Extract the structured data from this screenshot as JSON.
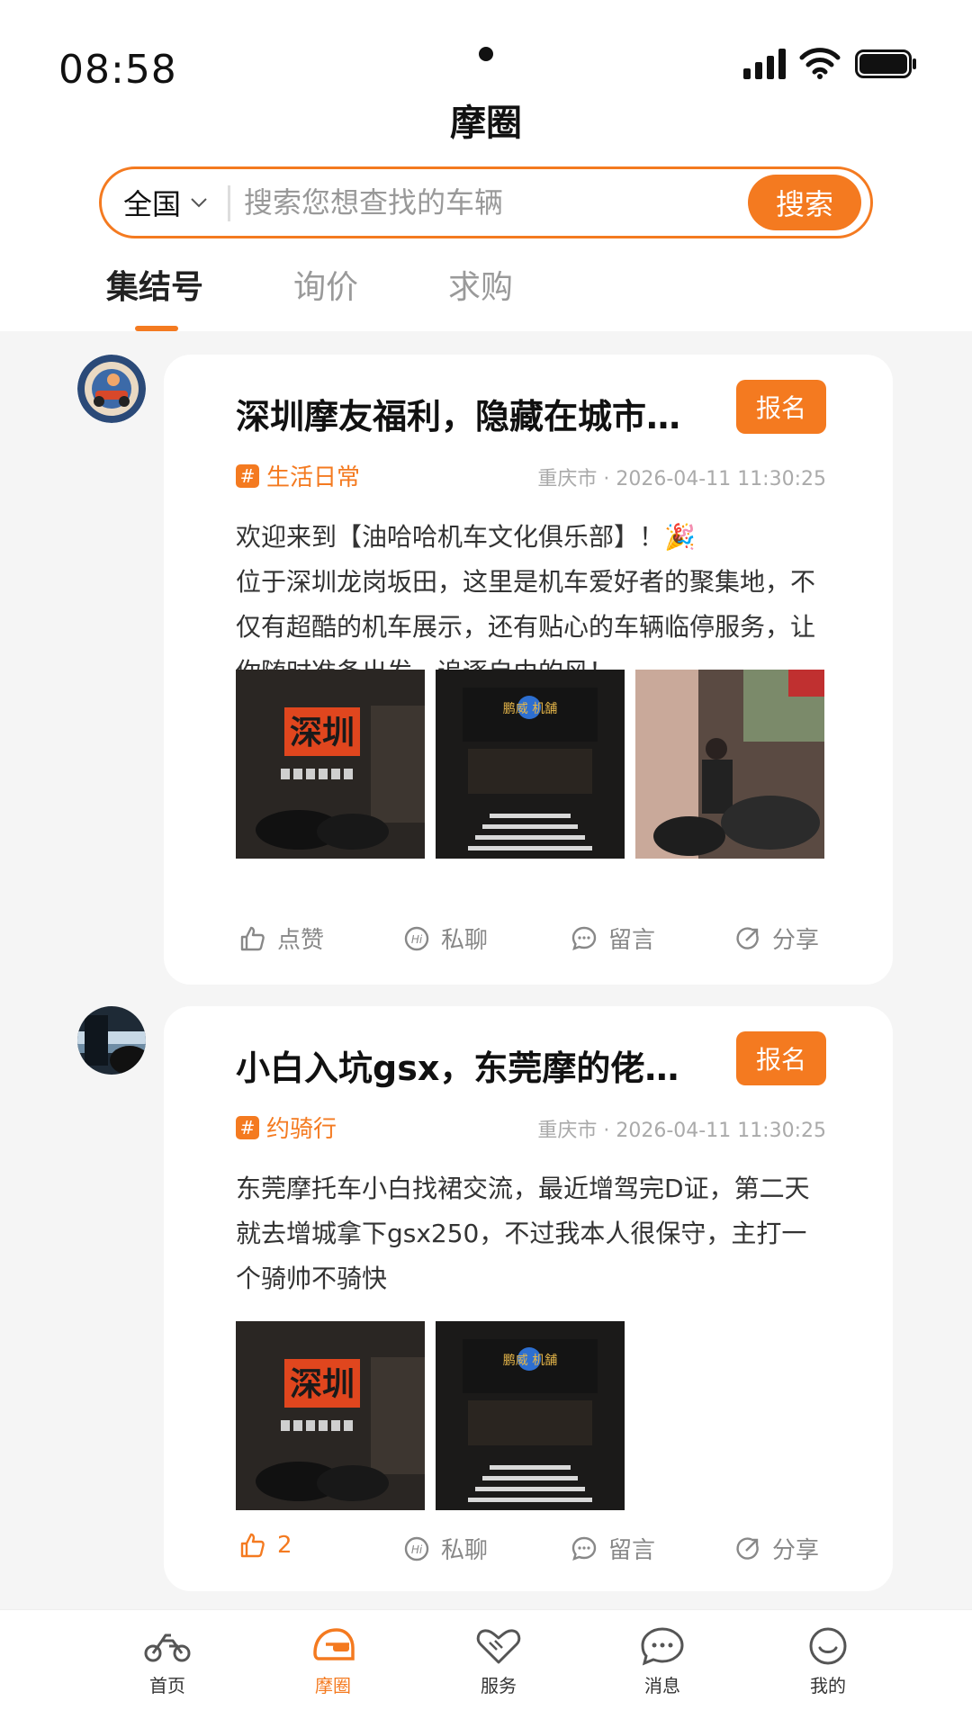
{
  "status_bar": {
    "time": "08:58"
  },
  "header": {
    "title": "摩圈"
  },
  "search": {
    "region": "全国",
    "placeholder": "搜索您想查找的车辆",
    "button": "搜索"
  },
  "tabs": [
    {
      "label": "集结号",
      "active": true
    },
    {
      "label": "询价",
      "active": false
    },
    {
      "label": "求购",
      "active": false
    }
  ],
  "posts": [
    {
      "title": "深圳摩友福利，隐藏在城市角...",
      "signup": "报名",
      "tag": "生活日常",
      "location": "重庆市",
      "datetime": "2026-04-11 11:30:25",
      "body_line1": "欢迎来到【油哈哈机车文化俱乐部】！🎉",
      "body_line2": "位于深圳龙岗坂田，这里是机车爱好者的聚集地，不仅有超酷的机车展示，还有贴心的车辆临停服务，让你随时准备出发，追逐自由的风！",
      "images": [
        "深圳",
        "鹏威 机舗",
        ""
      ],
      "like_label": "点赞",
      "chat_label": "私聊",
      "comment_label": "留言",
      "share_label": "分享"
    },
    {
      "title": "小白入坑gsx，东莞摩的佬交流",
      "signup": "报名",
      "tag": "约骑行",
      "location": "重庆市",
      "datetime": "2026-04-11 11:30:25",
      "body": "东莞摩托车小白找裙交流，最近增驾完D证，第二天就去增城拿下gsx250，不过我本人很保守，主打一个骑帅不骑快",
      "images": [
        "深圳",
        "鹏威 机舗"
      ],
      "like_count": "2",
      "chat_label": "私聊",
      "comment_label": "留言",
      "share_label": "分享"
    }
  ],
  "bottom_nav": [
    {
      "label": "首页",
      "icon": "motorcycle-icon",
      "active": false
    },
    {
      "label": "摩圈",
      "icon": "helmet-icon",
      "active": true
    },
    {
      "label": "服务",
      "icon": "heart-handshake-icon",
      "active": false
    },
    {
      "label": "消息",
      "icon": "chat-bubble-icon",
      "active": false
    },
    {
      "label": "我的",
      "icon": "smile-icon",
      "active": false
    }
  ],
  "colors": {
    "accent": "#f47a20",
    "background": "#f5f5f5"
  }
}
